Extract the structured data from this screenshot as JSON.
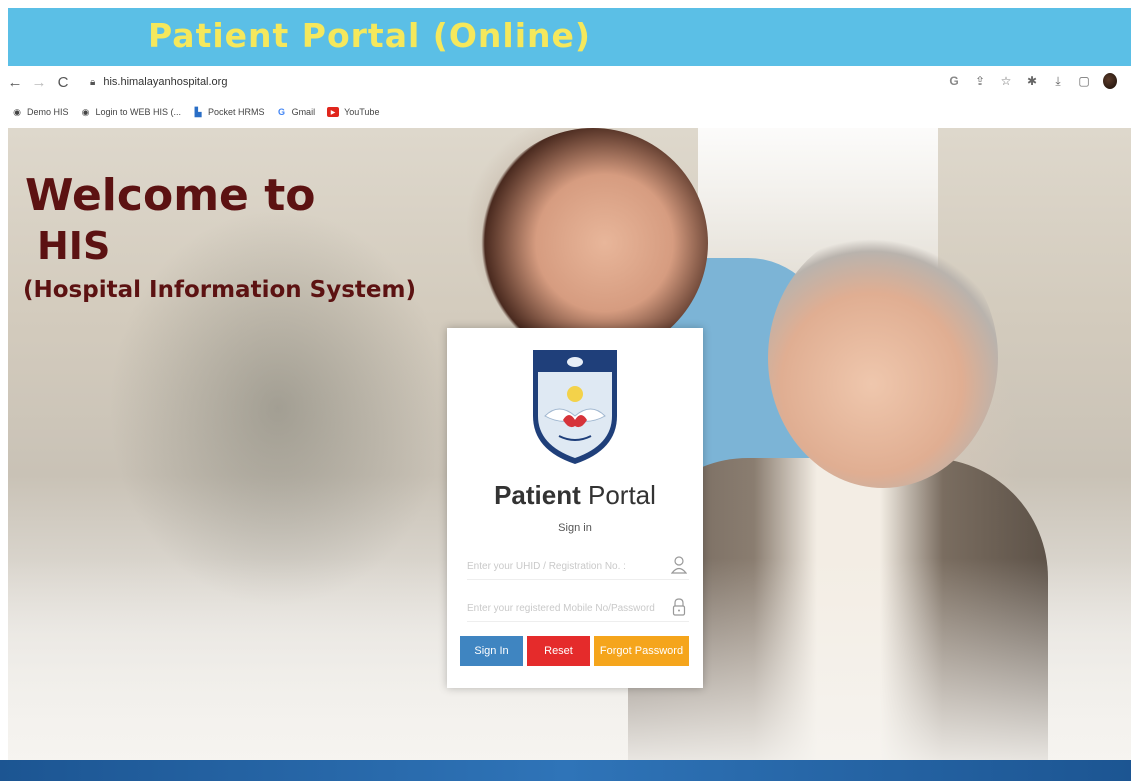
{
  "banner": {
    "title": "Patient Portal (Online)"
  },
  "browser": {
    "url": "his.himalayanhospital.org",
    "bookmarks": [
      {
        "label": "Demo HIS",
        "icon": "globe-icon"
      },
      {
        "label": "Login to WEB HIS (...",
        "icon": "globe-icon"
      },
      {
        "label": "Pocket HRMS",
        "icon": "pocket-hrms-icon"
      },
      {
        "label": "Gmail",
        "icon": "google-icon"
      },
      {
        "label": "YouTube",
        "icon": "youtube-icon"
      }
    ]
  },
  "hero": {
    "welcome_line1": "Welcome to",
    "welcome_line2": "HIS",
    "welcome_line3": "(Hospital Information System)"
  },
  "login": {
    "title_bold": "Patient",
    "title_rest": " Portal",
    "subtitle": "Sign in",
    "uhid_placeholder": "Enter your UHID / Registration No. :",
    "password_placeholder": "Enter your registered Mobile No/Password",
    "signin_label": "Sign In",
    "reset_label": "Reset",
    "forgot_label": "Forgot Password"
  },
  "colors": {
    "banner_bg": "#5bbfe6",
    "banner_text": "#f5e85c",
    "welcome_text": "#5c1212",
    "signin": "#3f85c1",
    "reset": "#e52b2b",
    "forgot": "#f5a51c"
  }
}
